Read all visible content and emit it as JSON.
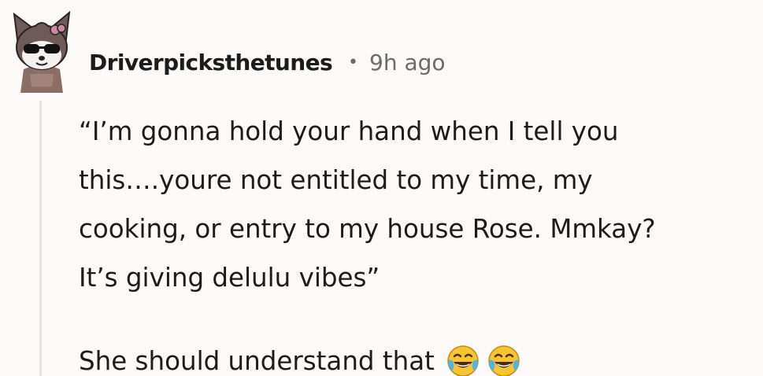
{
  "comment": {
    "username": "Driverpicksthetunes",
    "separator": "•",
    "timestamp": "9h ago",
    "quote_lines": [
      "“I’m gonna hold your hand when I tell you",
      "this….youre not entitled to my time, my",
      "cooking, or entry to my house Rose. Mmkay?",
      "It’s giving delulu vibes”"
    ],
    "reply_text": "She should understand that",
    "emojis": [
      "face-with-tears-of-joy",
      "face-with-tears-of-joy"
    ]
  },
  "colors": {
    "background": "#fbfaf9",
    "text": "#1c1c1c",
    "meta": "#6b6b6b",
    "thread_line": "#e5e3e0"
  }
}
